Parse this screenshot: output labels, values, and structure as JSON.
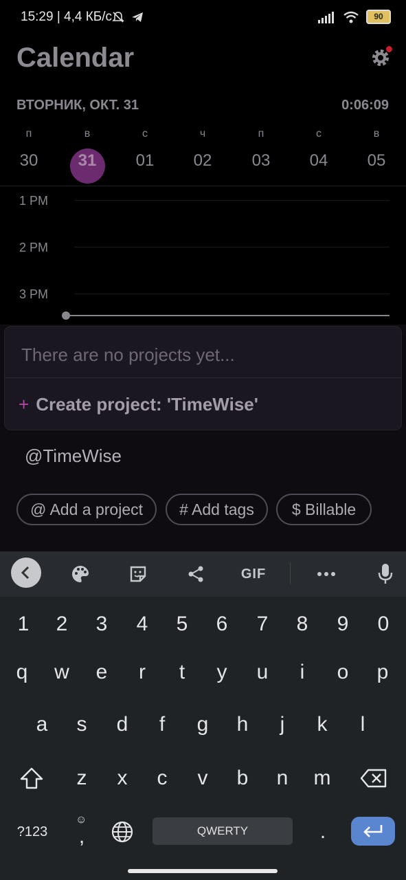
{
  "status_bar": {
    "time": "15:29 | 4,4 КБ/с",
    "battery": "90"
  },
  "header": {
    "title": "Calendar",
    "date_label": "ВТОРНИК, ОКТ. 31",
    "timer": "0:06:09"
  },
  "week": [
    {
      "letter": "п",
      "date": "30"
    },
    {
      "letter": "в",
      "date": "31",
      "selected": true
    },
    {
      "letter": "с",
      "date": "01"
    },
    {
      "letter": "ч",
      "date": "02"
    },
    {
      "letter": "п",
      "date": "03"
    },
    {
      "letter": "с",
      "date": "04"
    },
    {
      "letter": "в",
      "date": "05"
    }
  ],
  "timeline": {
    "hours": [
      "1 PM",
      "2 PM",
      "3 PM"
    ]
  },
  "project_dropdown": {
    "empty_text": "There are no projects yet...",
    "create_label": "Create project: 'TimeWise'"
  },
  "entry": {
    "text": "@TimeWise"
  },
  "chips": {
    "project": "@ Add a project",
    "tags": "# Add tags",
    "billable": "$  Billable"
  },
  "keyboard": {
    "toolbar_gif": "GIF",
    "digits": [
      "1",
      "2",
      "3",
      "4",
      "5",
      "6",
      "7",
      "8",
      "9",
      "0"
    ],
    "row1": [
      "q",
      "w",
      "e",
      "r",
      "t",
      "y",
      "u",
      "i",
      "o",
      "p"
    ],
    "row2": [
      "a",
      "s",
      "d",
      "f",
      "g",
      "h",
      "j",
      "k",
      "l"
    ],
    "row3": [
      "z",
      "x",
      "c",
      "v",
      "b",
      "n",
      "m"
    ],
    "symbols": "?123",
    "emoji_comma": ",",
    "space": "QWERTY",
    "period": "."
  },
  "colors": {
    "selected_day": "#6b2b6e",
    "accent_plus": "#b04aa8",
    "enter_key": "#5a86d0"
  }
}
